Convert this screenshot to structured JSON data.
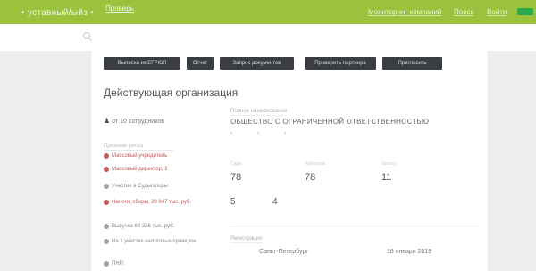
{
  "header": {
    "logo_text": "• уставный/ыйз •",
    "brand_link": "Проверь",
    "links": [
      "Мониторинг компаний",
      "Поиск",
      "Войти"
    ],
    "colors": {
      "bar": "#9ac23c",
      "login": "#2ea84d"
    }
  },
  "actions": {
    "buttons": [
      "Выписка из ЕГРЮЛ",
      "Отчет",
      "Запрос документов",
      "Проверить партнера",
      "Пригласить"
    ]
  },
  "company": {
    "status_title": "Действующая организация",
    "ogrn": "от 10 сотрудников",
    "full_name_label": "Полное наименование",
    "full_name": "ОБЩЕСТВО С ОГРАНИЧЕННОЙ ОТВЕТСТВЕННОСТЬЮ",
    "tags": [
      "▪",
      "▪",
      "▪"
    ]
  },
  "risks": {
    "title": "Признаки риска",
    "items": [
      {
        "text": "Массовый учредитель",
        "color": "#c25959"
      },
      {
        "text": "Массовый директор, 1",
        "color": "#c25959"
      },
      {
        "text": "Участие в Суды/споры",
        "color": "#9aa7a0"
      },
      {
        "text": "Налоги, сборы, 20 847 тыс. руб.",
        "color": "#c25959"
      },
      {
        "text": "Выручка 68 236 тыс. руб.",
        "color": "#9aa7a0"
      },
      {
        "text": "На 1 участке налоговых проверок",
        "color": "#9aa7a0"
      },
      {
        "text": "ПНП",
        "color": "#9aa7a0"
      }
    ]
  },
  "stats": {
    "labels": [
      "Суды",
      "Арбитраж",
      "Залоги"
    ],
    "values": [
      "78",
      "78",
      "11"
    ],
    "small_values": [
      "5",
      "4"
    ]
  },
  "registration": {
    "label": "Регистрация",
    "city": "Санкт-Петербург",
    "date": "18 января 2019"
  }
}
